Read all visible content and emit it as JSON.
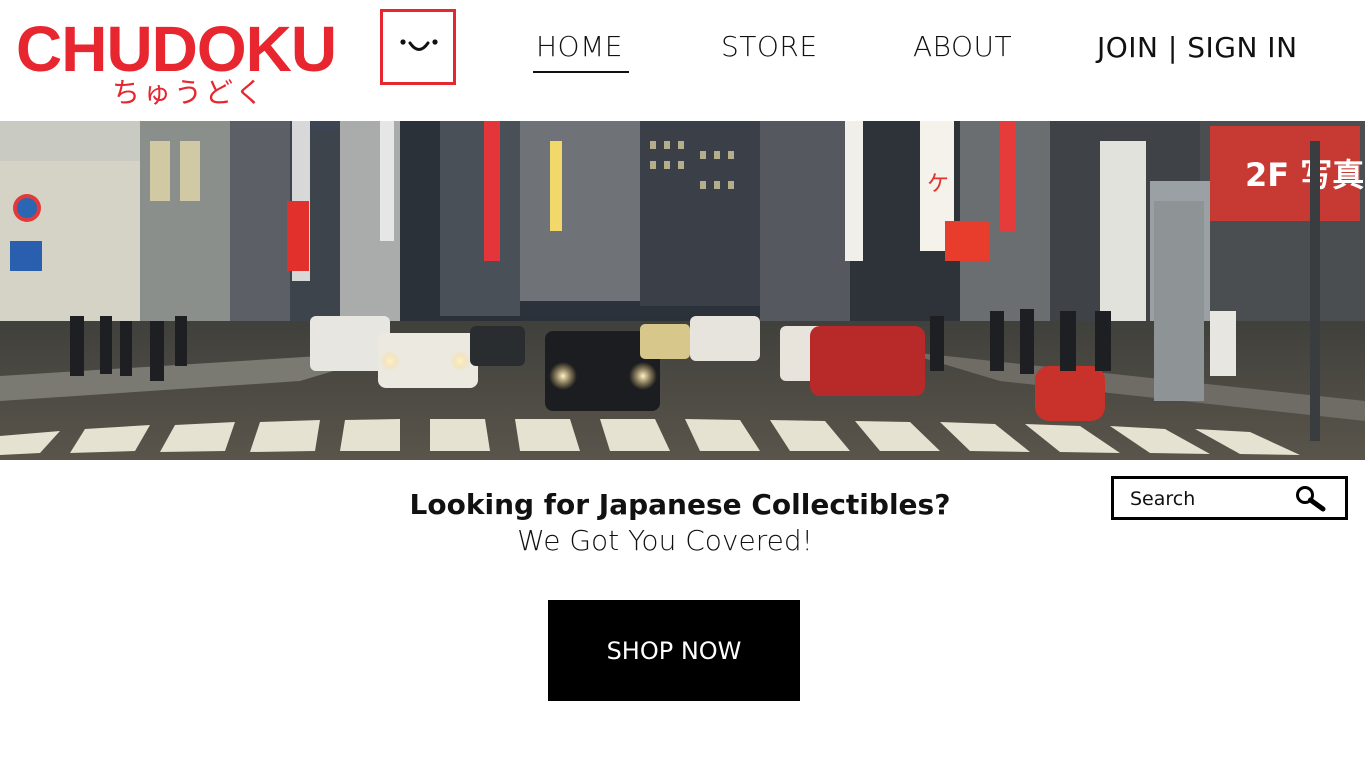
{
  "logo": {
    "brand": "CHUDOKU",
    "kana": "ちゅうどく",
    "icon": "smiley-face-icon",
    "accent": "#e8262f"
  },
  "nav": {
    "home": "HOME",
    "store": "STORE",
    "about": "ABOUT",
    "join": "JOIN",
    "separator": " | ",
    "sign_in": "SIGN IN"
  },
  "hero": {
    "image": "tokyo-street-night-photo"
  },
  "main": {
    "headline": "Looking for Japanese Collectibles?",
    "subline": "We Got You Covered!",
    "cta": "SHOP NOW"
  },
  "search": {
    "placeholder": "Search",
    "value": "",
    "icon": "search-icon"
  }
}
